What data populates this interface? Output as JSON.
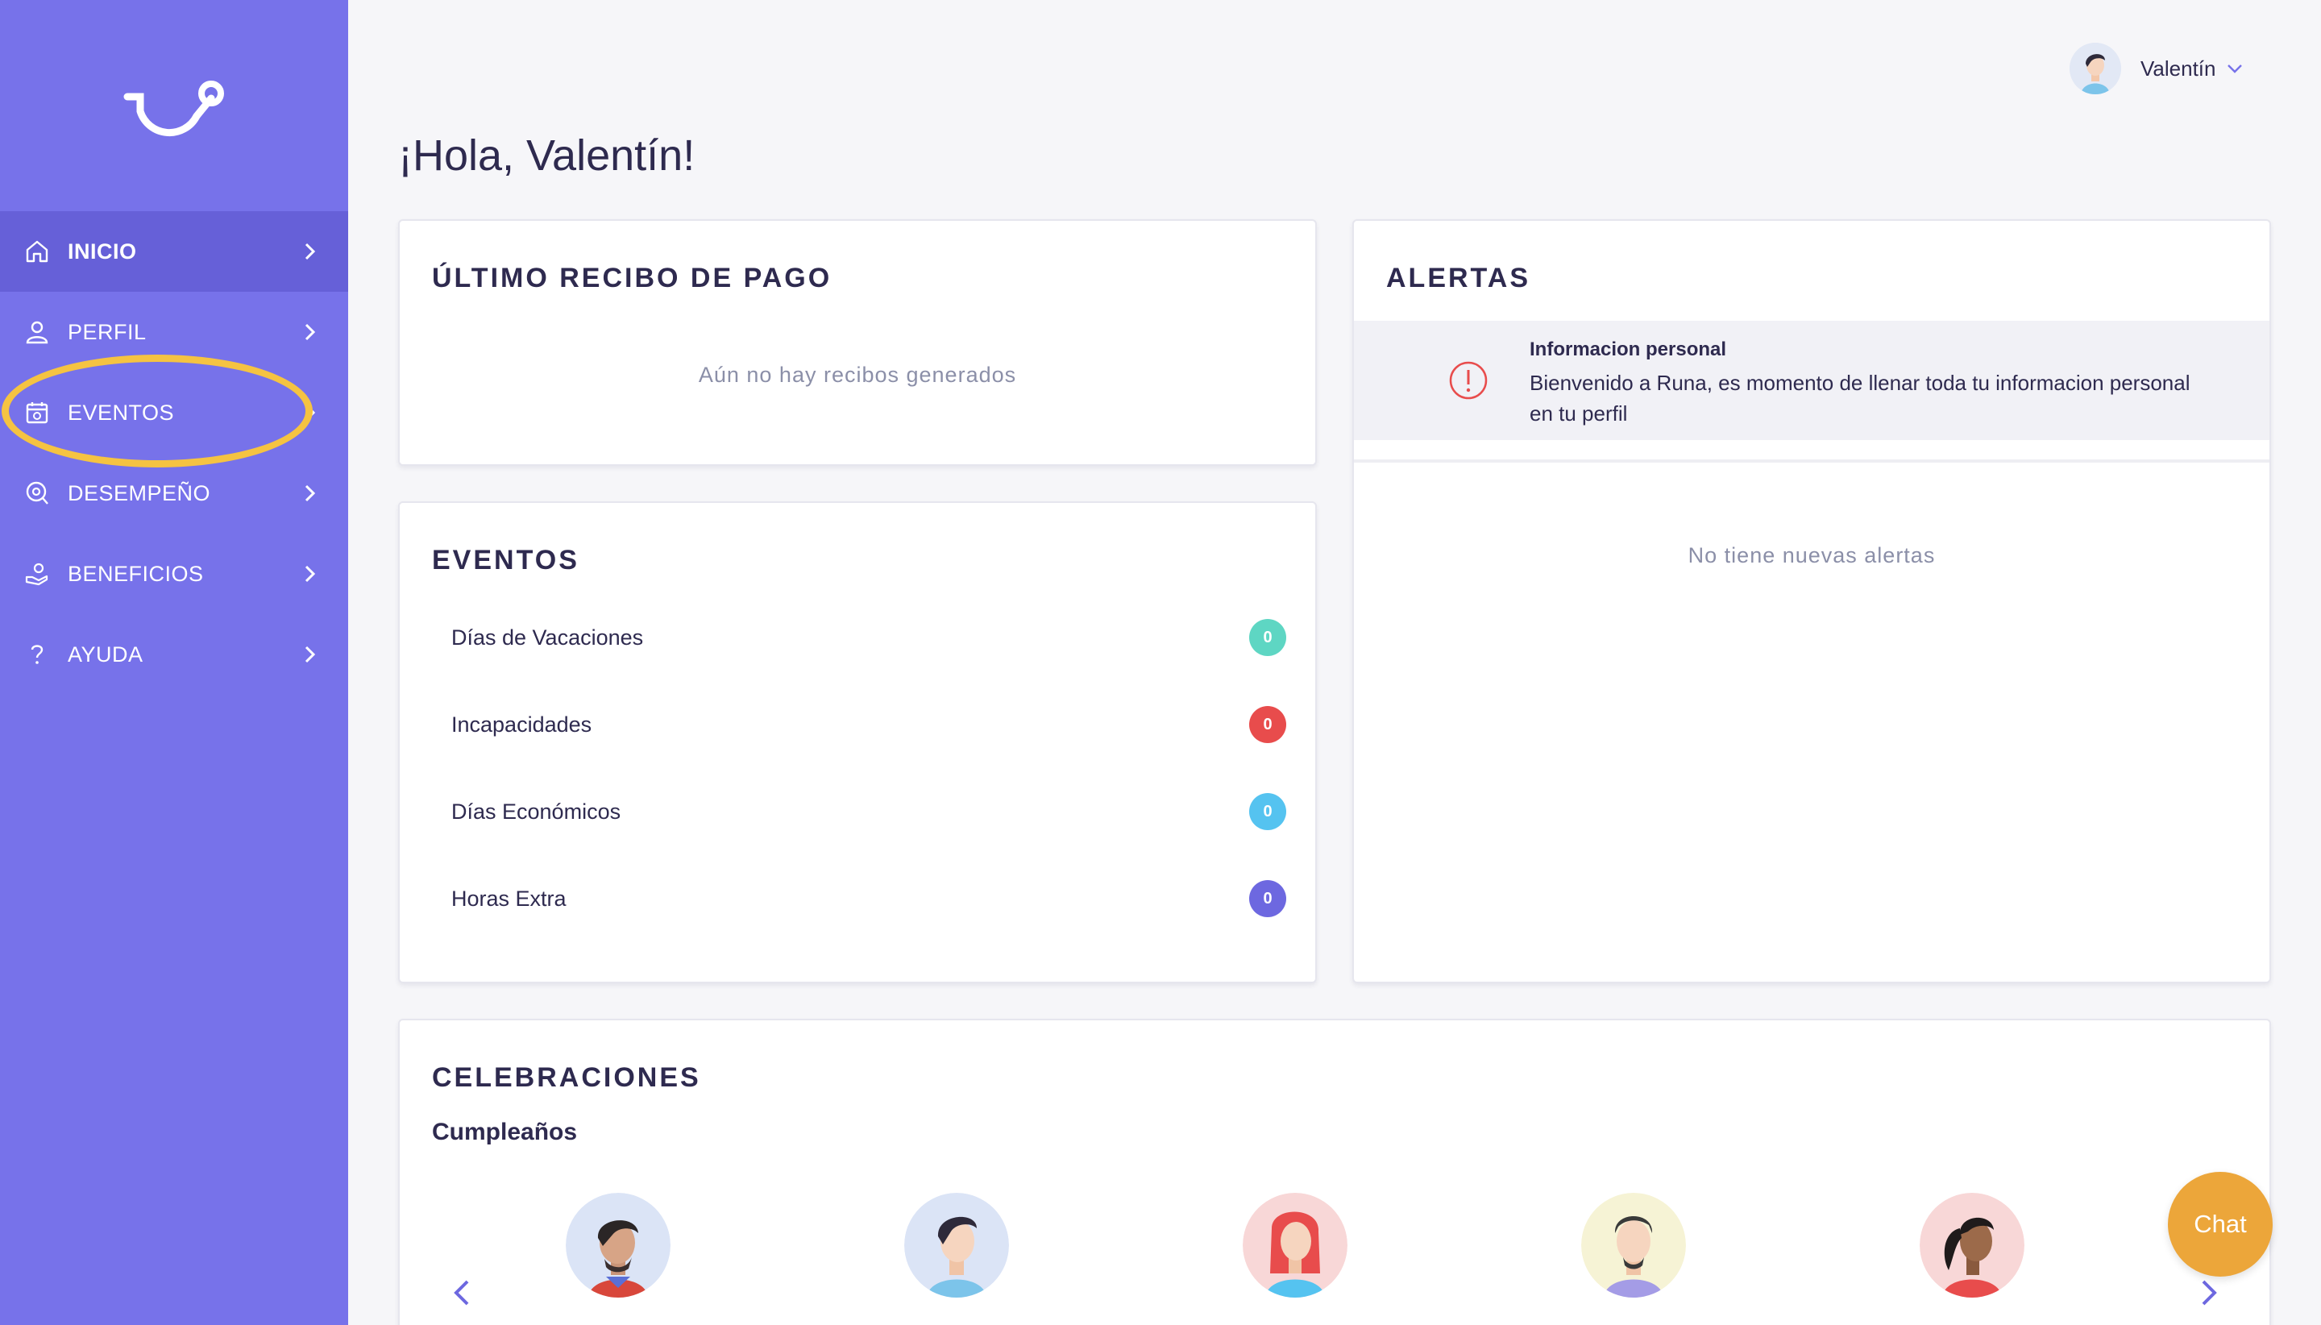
{
  "sidebar": {
    "items": [
      {
        "label": "INICIO",
        "icon": "home-icon",
        "active": true
      },
      {
        "label": "PERFIL",
        "icon": "user-icon"
      },
      {
        "label": "EVENTOS",
        "icon": "calendar-icon"
      },
      {
        "label": "DESEMPEÑO",
        "icon": "performance-icon"
      },
      {
        "label": "BENEFICIOS",
        "icon": "benefits-icon"
      },
      {
        "label": "AYUDA",
        "icon": "help-icon"
      }
    ]
  },
  "user": {
    "name": "Valentín"
  },
  "greeting": "¡Hola, Valentín!",
  "recibo": {
    "title": "ÚLTIMO RECIBO DE PAGO",
    "empty": "Aún no hay recibos generados"
  },
  "eventos": {
    "title": "EVENTOS",
    "items": [
      {
        "label": "Días de Vacaciones",
        "count": "0",
        "color": "#5ed6c3"
      },
      {
        "label": "Incapacidades",
        "count": "0",
        "color": "#e84c4c"
      },
      {
        "label": "Días Económicos",
        "count": "0",
        "color": "#55c3f0"
      },
      {
        "label": "Horas Extra",
        "count": "0",
        "color": "#6d68e0"
      }
    ]
  },
  "alertas": {
    "title": "ALERTAS",
    "alert": {
      "title": "Informacion personal",
      "text": "Bienvenido a Runa, es momento de llenar toda tu informacion personal en tu perfil"
    },
    "empty": "No tiene nuevas alertas"
  },
  "celebraciones": {
    "title": "CELEBRACIONES",
    "subtitle": "Cumpleaños"
  },
  "chat": {
    "label": "Chat"
  },
  "colors": {
    "sidebar": "#7772ea",
    "active": "#6660d8",
    "highlight": "#f5c342",
    "chat": "#eca63a"
  }
}
